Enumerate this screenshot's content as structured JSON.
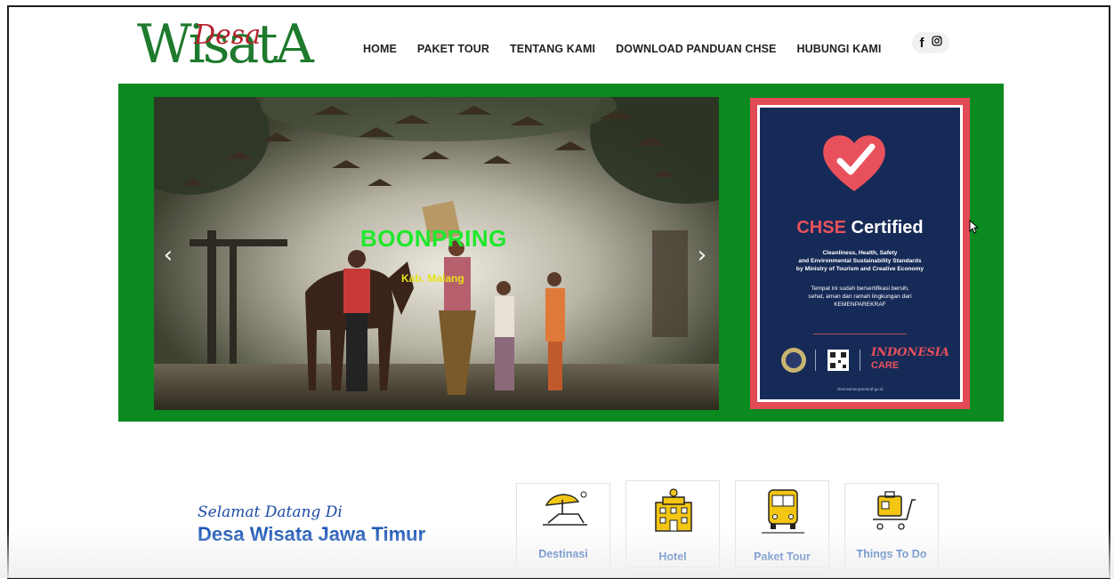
{
  "logo": {
    "main": "WisatA",
    "accent": "Desa"
  },
  "nav": {
    "items": [
      "HOME",
      "PAKET TOUR",
      "TENTANG KAMI",
      "DOWNLOAD PANDUAN CHSE",
      "HUBUNGI KAMI"
    ]
  },
  "social": {
    "facebook": "f",
    "icons": [
      "facebook-icon",
      "instagram-icon"
    ]
  },
  "hero": {
    "background_color": "#0b8a1f",
    "slide": {
      "title": "BOONPRING",
      "subtitle": "Kab. Malang",
      "title_color": "#1ee82c",
      "subtitle_color": "#e7e21a"
    },
    "prev_label": "‹",
    "next_label": "›",
    "certificate": {
      "title_red": "CHSE",
      "title_white": "Certified",
      "lines": [
        "Cleanliness, Health, Safety",
        "and Environmental Sustainability Standards",
        "by Ministry of Tourism and Creative Economy"
      ],
      "note": [
        "Tempat ini sudah bersertifikasi bersih,",
        "sehat, aman dan ramah lingkungan dari",
        "KEMENPAREKRAF"
      ],
      "brand_top": "INDONESIA",
      "brand_bottom": "CARE",
      "footer": "chse.kemenparekraf.go.id"
    }
  },
  "welcome": {
    "small": "Selamat Datang Di",
    "big": "Desa Wisata Jawa Timur"
  },
  "cards": [
    {
      "label": "Destinasi",
      "icon": "beach-chair-icon"
    },
    {
      "label": "Hotel",
      "icon": "hotel-icon"
    },
    {
      "label": "Paket Tour",
      "icon": "bus-icon"
    },
    {
      "label": "Things To Do",
      "icon": "luggage-cart-icon"
    }
  ]
}
